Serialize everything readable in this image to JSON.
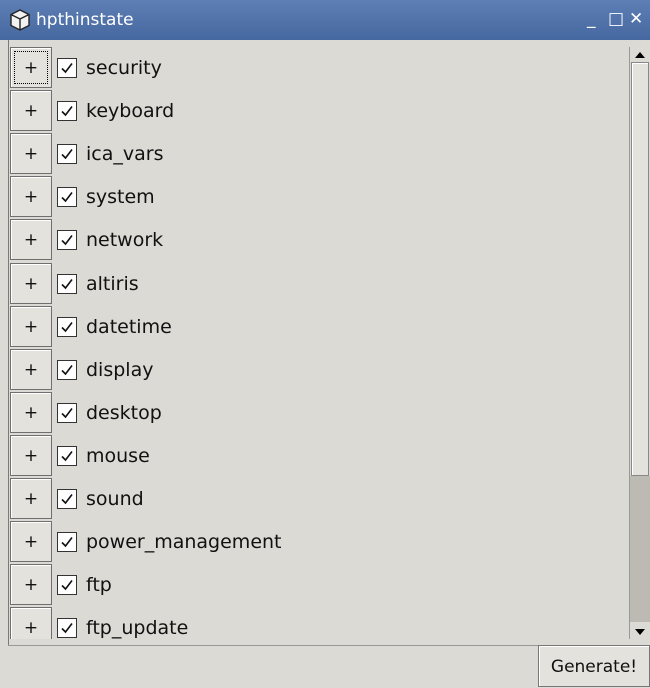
{
  "window": {
    "title": "hpthinstate",
    "minimize_glyph": "_",
    "maximize_glyph": "□",
    "close_glyph": "✕"
  },
  "items": [
    {
      "expander": "+",
      "checked": true,
      "label": "security"
    },
    {
      "expander": "+",
      "checked": true,
      "label": "keyboard"
    },
    {
      "expander": "+",
      "checked": true,
      "label": "ica_vars"
    },
    {
      "expander": "+",
      "checked": true,
      "label": "system"
    },
    {
      "expander": "+",
      "checked": true,
      "label": "network"
    },
    {
      "expander": "+",
      "checked": true,
      "label": "altiris"
    },
    {
      "expander": "+",
      "checked": true,
      "label": "datetime"
    },
    {
      "expander": "+",
      "checked": true,
      "label": "display"
    },
    {
      "expander": "+",
      "checked": true,
      "label": "desktop"
    },
    {
      "expander": "+",
      "checked": true,
      "label": "mouse"
    },
    {
      "expander": "+",
      "checked": true,
      "label": "sound"
    },
    {
      "expander": "+",
      "checked": true,
      "label": "power_management"
    },
    {
      "expander": "+",
      "checked": true,
      "label": "ftp"
    },
    {
      "expander": "+",
      "checked": true,
      "label": "ftp_update"
    }
  ],
  "footer": {
    "generate_label": "Generate!"
  },
  "icons": {
    "app": "cube-icon",
    "check": "checkmark-icon"
  }
}
